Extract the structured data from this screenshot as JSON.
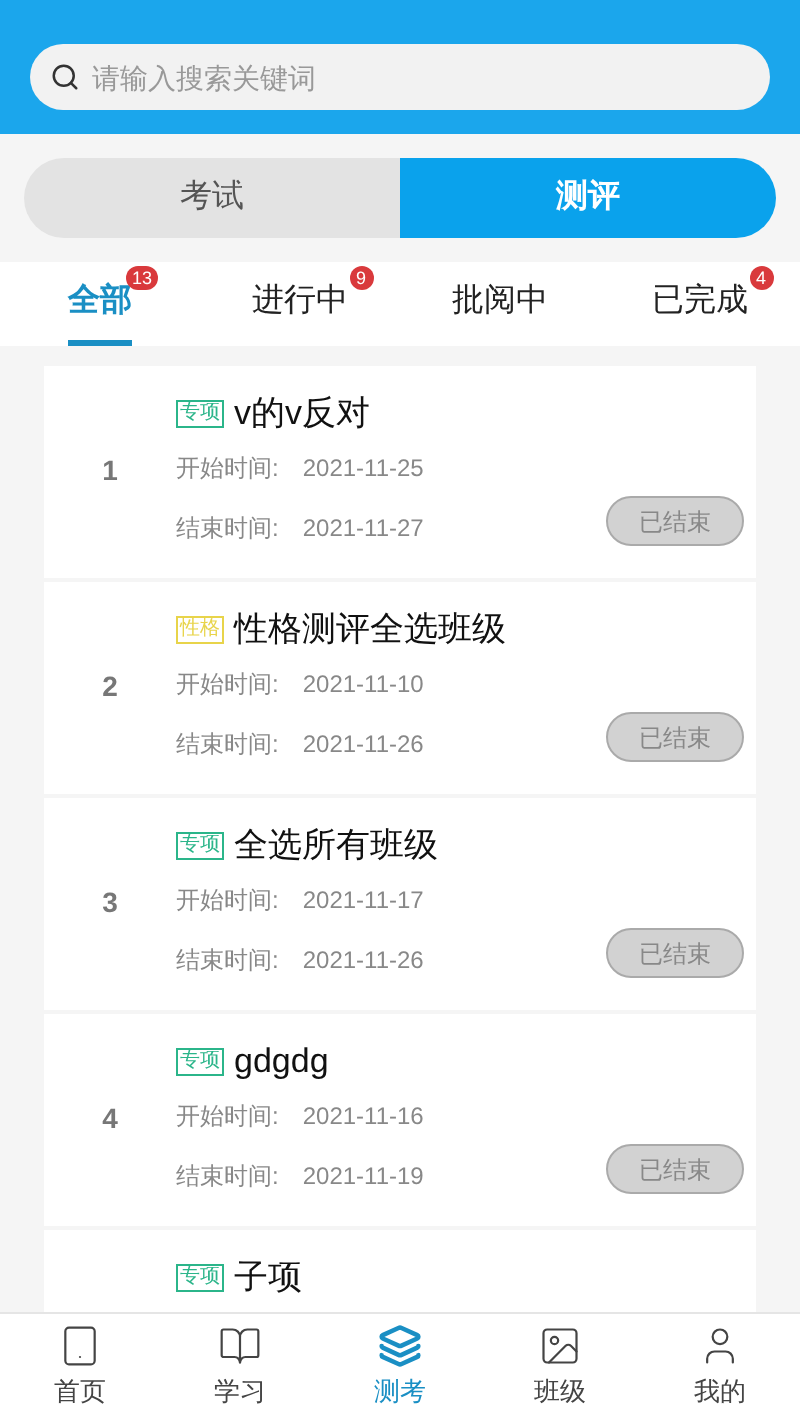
{
  "search": {
    "placeholder": "请输入搜索关键词"
  },
  "segments": [
    {
      "label": "考试",
      "selected": false
    },
    {
      "label": "测评",
      "selected": true
    }
  ],
  "tabs": [
    {
      "label": "全部",
      "badge": "13",
      "selected": true
    },
    {
      "label": "进行中",
      "badge": "9",
      "selected": false
    },
    {
      "label": "批阅中",
      "selected": false
    },
    {
      "label": "已完成",
      "badge": "4",
      "selected": false
    }
  ],
  "items": [
    {
      "index": "1",
      "tag": {
        "label": "专项",
        "color": "#2bb58a"
      },
      "title": "v的v反对",
      "start_label": "开始时间:",
      "start": "2021-11-25",
      "end_label": "结束时间:",
      "end": "2021-11-27",
      "status": "已结束"
    },
    {
      "index": "2",
      "tag": {
        "label": "性格",
        "color": "#e8d44a"
      },
      "title": "性格测评全选班级",
      "start_label": "开始时间:",
      "start": "2021-11-10",
      "end_label": "结束时间:",
      "end": "2021-11-26",
      "status": "已结束"
    },
    {
      "index": "3",
      "tag": {
        "label": "专项",
        "color": "#2bb58a"
      },
      "title": "全选所有班级",
      "start_label": "开始时间:",
      "start": "2021-11-17",
      "end_label": "结束时间:",
      "end": "2021-11-26",
      "status": "已结束"
    },
    {
      "index": "4",
      "tag": {
        "label": "专项",
        "color": "#2bb58a"
      },
      "title": "gdgdg",
      "start_label": "开始时间:",
      "start": "2021-11-16",
      "end_label": "结束时间:",
      "end": "2021-11-19",
      "status": "已结束"
    },
    {
      "tag": {
        "label": "专项",
        "color": "#2bb58a"
      },
      "title": "子项"
    }
  ],
  "nav": [
    {
      "label": "首页",
      "kind": "home",
      "selected": false
    },
    {
      "label": "学习",
      "kind": "study",
      "selected": false
    },
    {
      "label": "测考",
      "kind": "test",
      "selected": true
    },
    {
      "label": "班级",
      "kind": "class",
      "selected": false
    },
    {
      "label": "我的",
      "kind": "me",
      "selected": false
    }
  ]
}
